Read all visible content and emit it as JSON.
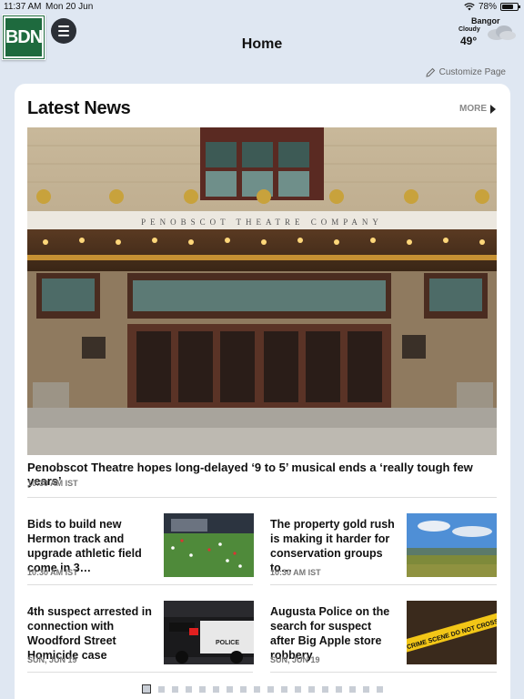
{
  "status": {
    "time": "11:37 AM",
    "date": "Mon 20 Jun",
    "battery": "78%",
    "battery_level": 0.78
  },
  "nav": {
    "logo": "BDN",
    "title": "Home",
    "menu_icon": "hamburger-icon"
  },
  "weather": {
    "city": "Bangor",
    "condition": "Cloudy",
    "temp": "49°",
    "icon": "cloud-icon"
  },
  "customize": {
    "label": "Customize Page",
    "icon": "pencil-icon"
  },
  "section": {
    "title": "Latest News",
    "more": "MORE"
  },
  "hero": {
    "title": "Penobscot Theatre hopes long-delayed ‘9 to 5’ musical ends a ‘really tough few years’",
    "time": "10:30 AM IST",
    "sign": "PENOBSCOT THEATRE COMPANY"
  },
  "stories": [
    {
      "title": "Bids to build new Hermon track and upgrade athletic field come in 3…",
      "time": "10:30 AM IST"
    },
    {
      "title": "The property gold rush is making it harder for conservation groups to…",
      "time": "10:30 AM IST"
    },
    {
      "title": "4th suspect arrested in connection with Woodford Street Homicide case",
      "time": "SUN, JUN 19"
    },
    {
      "title": "Augusta Police on the search for suspect after Big Apple store robbery",
      "time": "SUN, JUN 19"
    }
  ],
  "thumb_text": {
    "crime_tape": "CRIME SCENE DO NOT CROSS",
    "police": "POLICE"
  },
  "pager": {
    "total": 18,
    "active": 0
  }
}
